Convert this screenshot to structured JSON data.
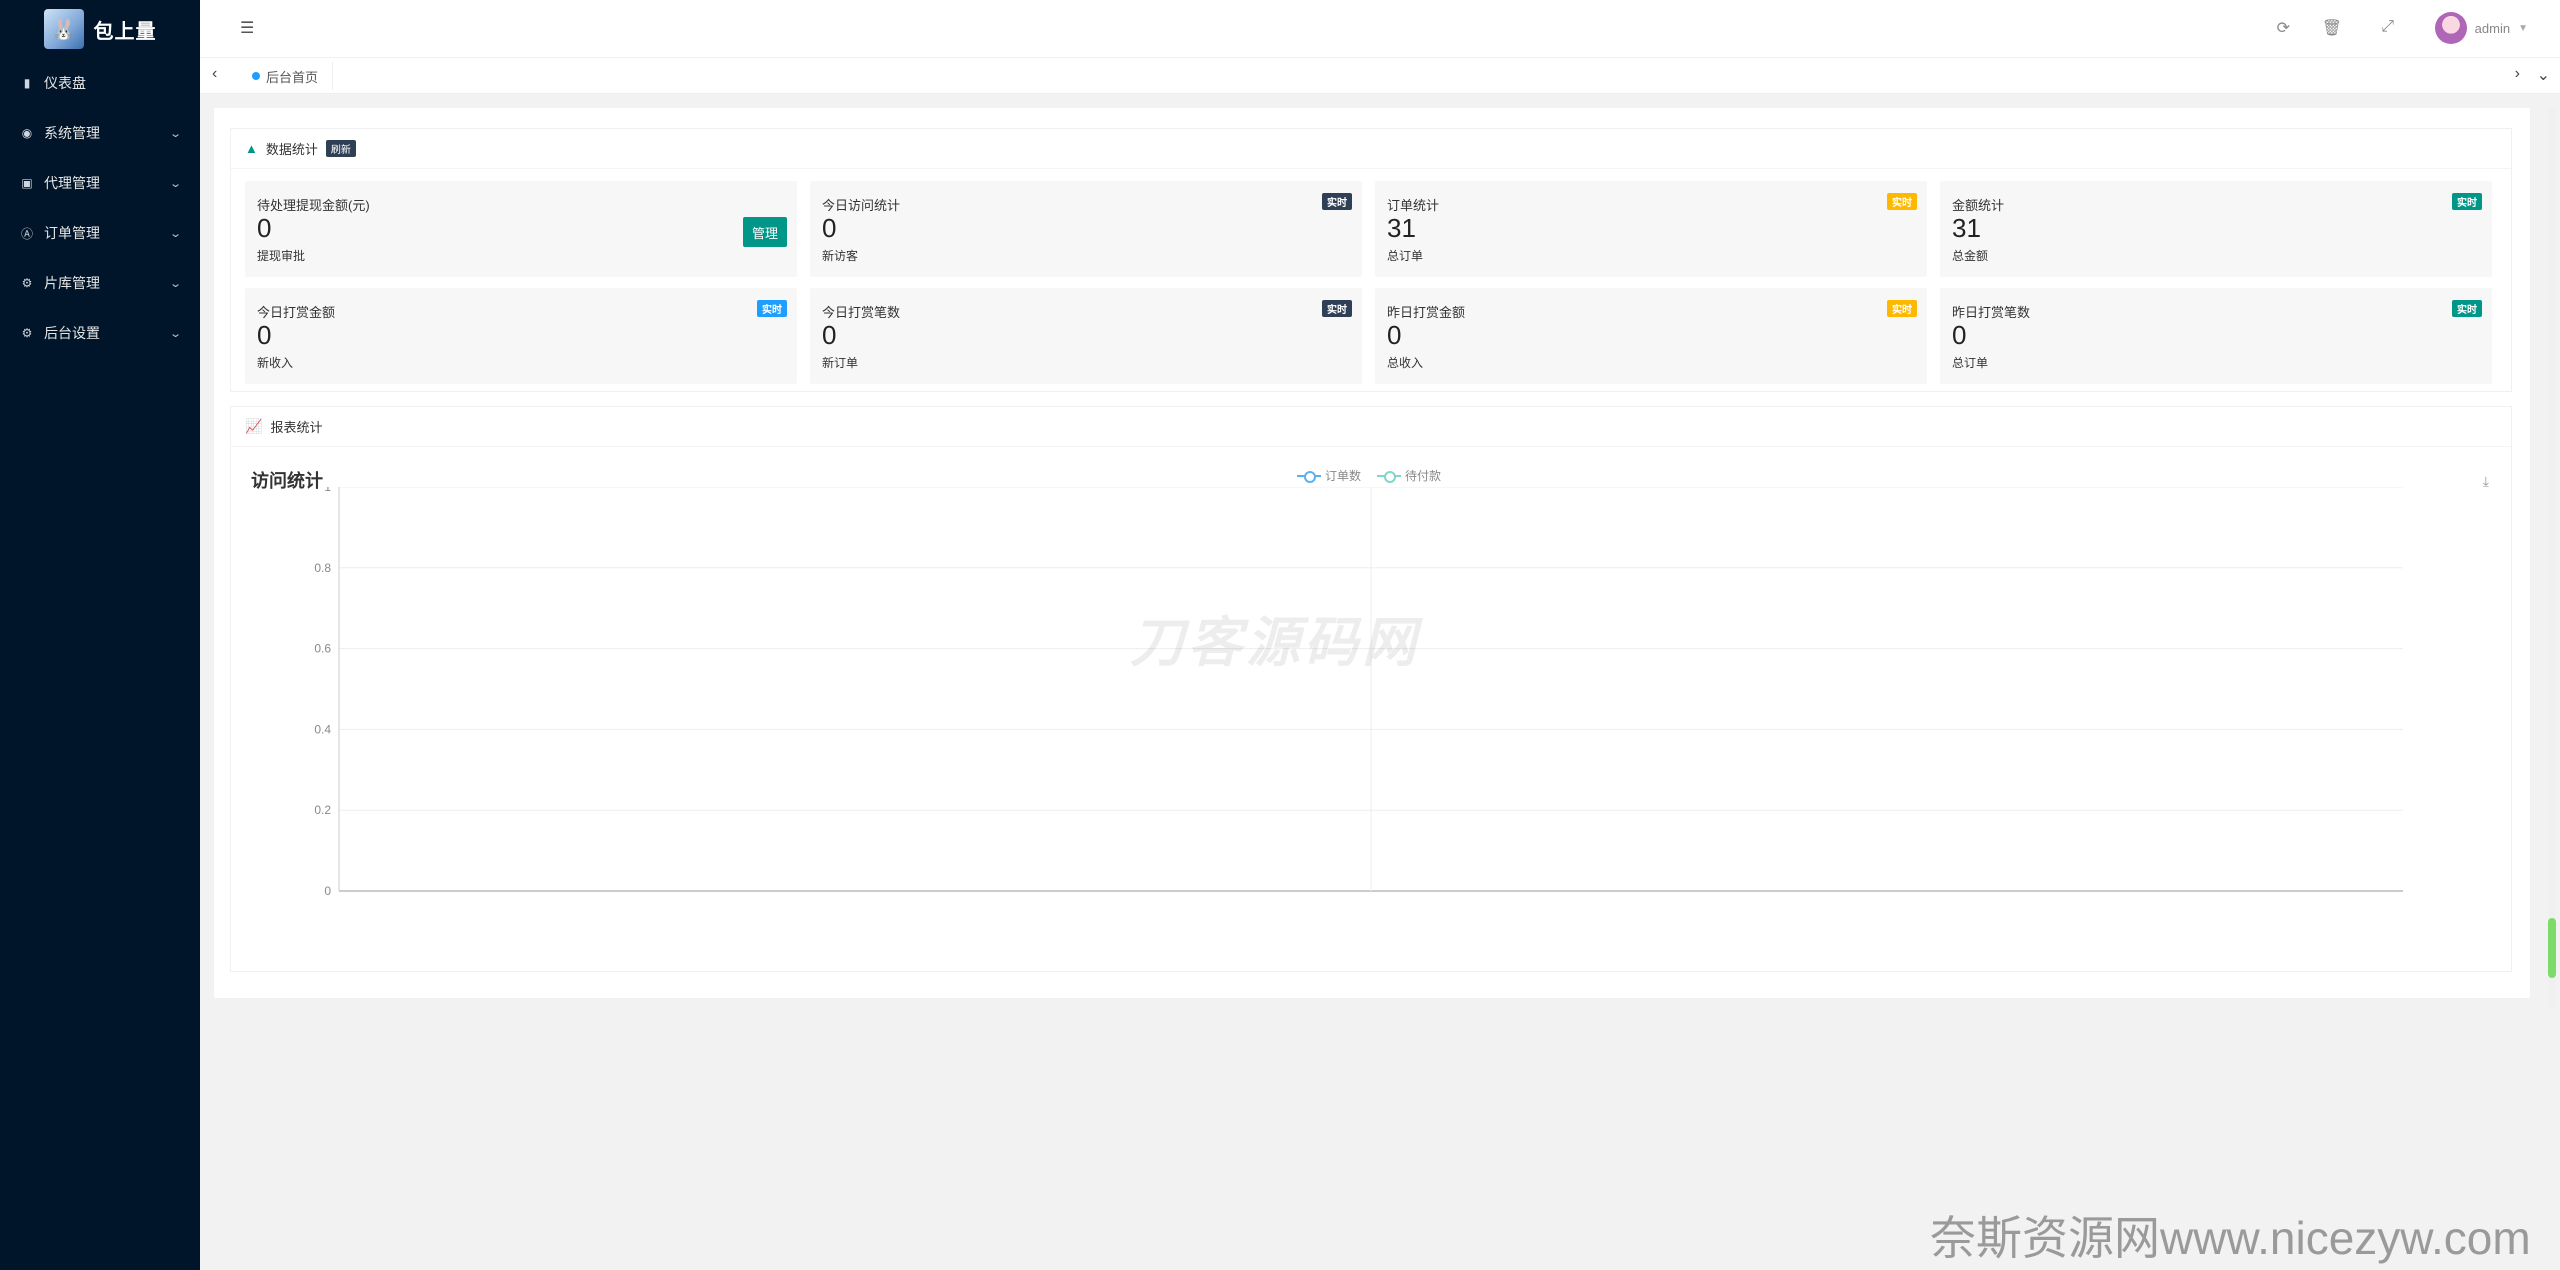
{
  "app": {
    "logo_text": "包上量"
  },
  "sidebar": {
    "items": [
      {
        "label": "仪表盘",
        "icon": "dashboard-icon",
        "has_children": false
      },
      {
        "label": "系统管理",
        "icon": "system-icon",
        "has_children": true
      },
      {
        "label": "代理管理",
        "icon": "agent-icon",
        "has_children": true
      },
      {
        "label": "订单管理",
        "icon": "order-icon",
        "has_children": true
      },
      {
        "label": "片库管理",
        "icon": "library-icon",
        "has_children": true
      },
      {
        "label": "后台设置",
        "icon": "settings-icon",
        "has_children": true
      }
    ]
  },
  "header": {
    "username": "admin"
  },
  "tabs": [
    {
      "label": "后台首页"
    }
  ],
  "stats_panel": {
    "title": "数据统计",
    "refresh_badge": "刷新",
    "cards": [
      {
        "title": "待处理提现金额(元)",
        "value": "0",
        "sub": "提现审批",
        "button": "管理"
      },
      {
        "title": "今日访问统计",
        "value": "0",
        "sub": "新访客",
        "badge": "实时",
        "badge_color": "#2f4056"
      },
      {
        "title": "订单统计",
        "value": "31",
        "sub": "总订单",
        "badge": "实时",
        "badge_color": "#ffb800"
      },
      {
        "title": "金额统计",
        "value": "31",
        "sub": "总金额",
        "badge": "实时",
        "badge_color": "#009688"
      },
      {
        "title": "今日打赏金额",
        "value": "0",
        "sub": "新收入",
        "badge": "实时",
        "badge_color": "#1e9fff"
      },
      {
        "title": "今日打赏笔数",
        "value": "0",
        "sub": "新订单",
        "badge": "实时",
        "badge_color": "#2f4056"
      },
      {
        "title": "昨日打赏金额",
        "value": "0",
        "sub": "总收入",
        "badge": "实时",
        "badge_color": "#ffb800"
      },
      {
        "title": "昨日打赏笔数",
        "value": "0",
        "sub": "总订单",
        "badge": "实时",
        "badge_color": "#009688"
      }
    ]
  },
  "report_panel": {
    "title": "报表统计"
  },
  "chart_data": {
    "type": "line",
    "title": "访问统计",
    "series": [
      {
        "name": "订单数",
        "color": "#5ab1ef",
        "values": []
      },
      {
        "name": "待付款",
        "color": "#7fd6c9",
        "values": []
      }
    ],
    "categories": [
      "",
      ""
    ],
    "ylim": [
      0,
      1
    ],
    "yticks": [
      "0",
      "0.2",
      "0.4",
      "0.6",
      "0.8",
      "1"
    ],
    "grid": true,
    "legend": "top-center"
  },
  "watermark": "刀客源码网",
  "footer_watermark": "奈斯资源网www.nicezyw.com"
}
